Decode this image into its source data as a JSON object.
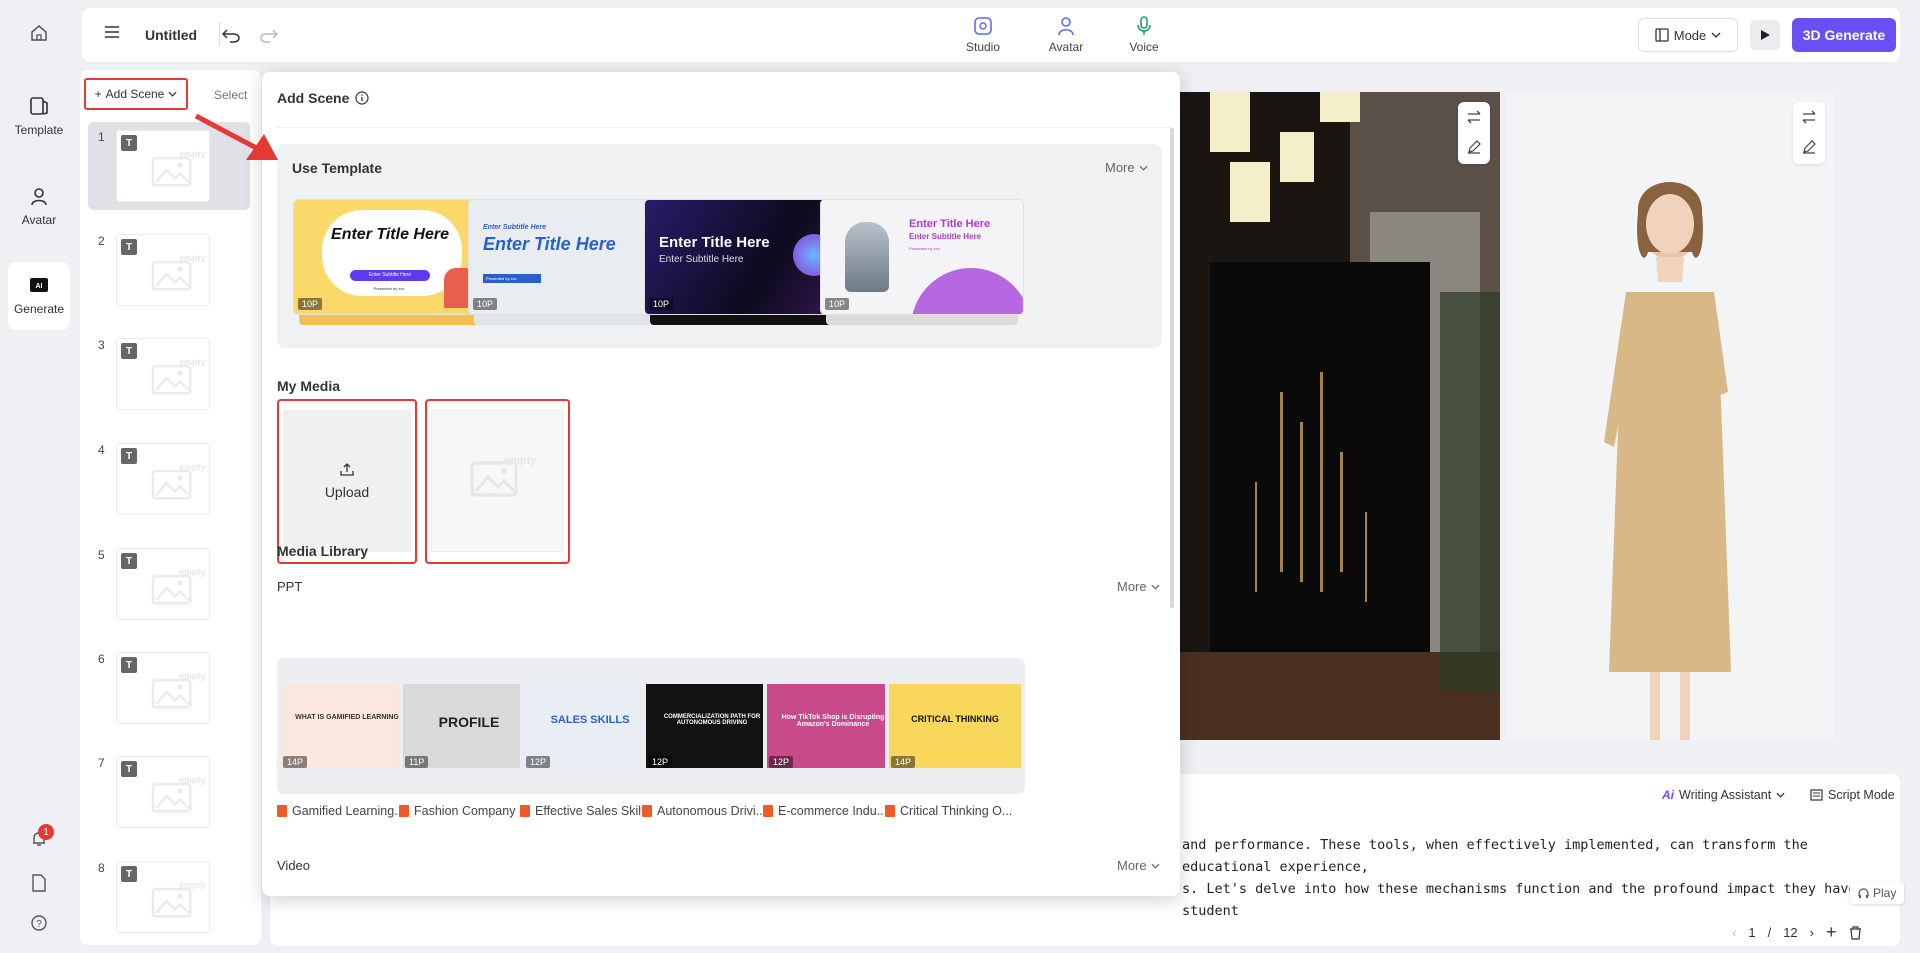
{
  "rail": {
    "items": [
      {
        "label": "Template"
      },
      {
        "label": "Avatar"
      },
      {
        "label": "Generate"
      }
    ],
    "notification_count": "1"
  },
  "topbar": {
    "title": "Untitled",
    "tabs": [
      {
        "label": "Studio"
      },
      {
        "label": "Avatar"
      },
      {
        "label": "Voice"
      }
    ],
    "mode_label": "Mode",
    "generate_label": "3D Generate"
  },
  "scenes": {
    "add_label": "Add Scene",
    "select_label": "Select",
    "badge": "T",
    "items": [
      "1",
      "2",
      "3",
      "4",
      "5",
      "6",
      "7",
      "8"
    ]
  },
  "popup": {
    "title": "Add Scene",
    "use_template": {
      "title": "Use Template",
      "more": "More",
      "cards": [
        {
          "title": "Enter Title Here",
          "subtitle": "Enter Subtitle Here",
          "foot": "Presented by xxx",
          "pages": "10P"
        },
        {
          "title": "Enter Title Here",
          "subtitle": "Enter Subtitle Here",
          "foot": "Presented by xxx",
          "pages": "10P"
        },
        {
          "title": "Enter Title Here",
          "subtitle": "Enter Subtitle Here",
          "pages": "10P"
        },
        {
          "title": "Enter Title Here",
          "subtitle": "Enter Subtitle Here",
          "foot": "Presented by xxx",
          "pages": "10P"
        }
      ]
    },
    "my_media": {
      "title": "My Media",
      "upload_label": "Upload",
      "empty_label": "empty"
    },
    "media_library": {
      "title": "Media Library",
      "ppt_title": "PPT",
      "ppt_more": "More",
      "ppts": [
        {
          "name": "Gamified Learning...",
          "pages": "14P",
          "cover": "WHAT IS GAMIFIED LEARNING"
        },
        {
          "name": "Fashion Company ...",
          "pages": "11P",
          "cover": "PROFILE"
        },
        {
          "name": "Effective Sales Skil...",
          "pages": "12P",
          "cover": "SALES SKILLS"
        },
        {
          "name": "Autonomous Drivi...",
          "pages": "12P",
          "cover": "COMMERCIALIZATION PATH FOR AUTONOMOUS DRIVING"
        },
        {
          "name": "E-commerce Indu...",
          "pages": "12P",
          "cover": "How TikTok Shop is Disrupting Amazon's Dominance"
        },
        {
          "name": "Critical Thinking O...",
          "pages": "14P",
          "cover": "CRITICAL THINKING"
        }
      ],
      "video_title": "Video",
      "video_more": "More"
    }
  },
  "script": {
    "writing_assistant": "Writing Assistant",
    "script_mode": "Script Mode",
    "line1": "and performance. These tools, when effectively implemented, can transform the educational experience,",
    "line2": "s. Let's delve into how these mechanisms function and the profound impact they have on student",
    "play_label": "Play",
    "page_current": "1",
    "page_sep": "/",
    "page_total": "12"
  },
  "colors": {
    "accent": "#6b4ff6",
    "highlight": "#e53935",
    "ppt_icon": "#f05a28"
  }
}
